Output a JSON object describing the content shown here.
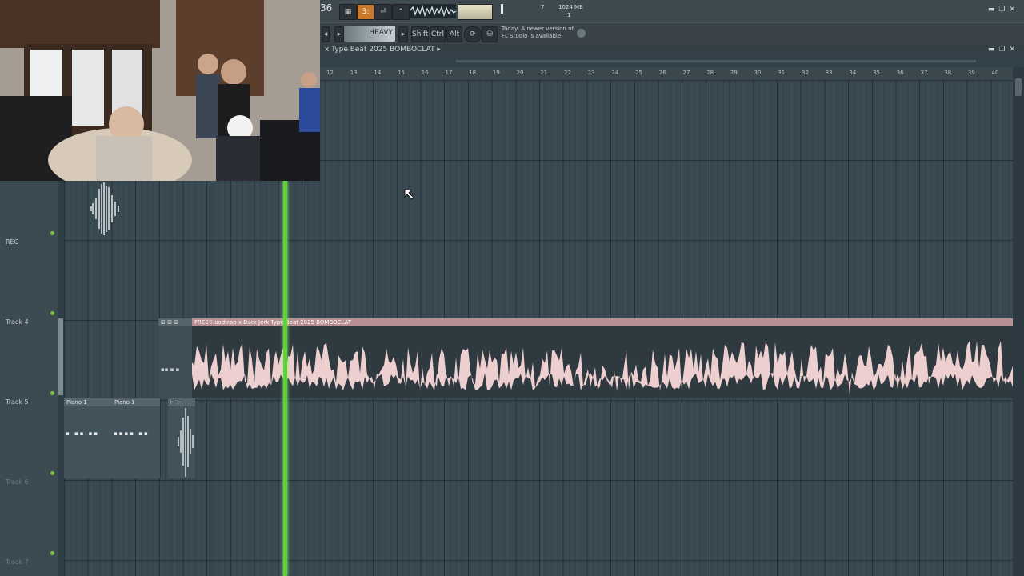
{
  "toolbar": {
    "counter_digits": "36",
    "preset_label": "HEAVY",
    "modifier_keys": [
      "Shift",
      "Ctrl",
      "Alt"
    ],
    "cpu_value": "7",
    "memory_value": "1024 MB",
    "voices_value": "1",
    "notification_day": "Today",
    "notification_line1": "A newer version of",
    "notification_line2": "FL Studio is available!"
  },
  "playlist": {
    "title": "x Type Beat 2025 BOMBOCLAT",
    "bar_numbers": [
      "12",
      "13",
      "14",
      "15",
      "16",
      "17",
      "18",
      "19",
      "20",
      "21",
      "22",
      "23",
      "24",
      "25",
      "26",
      "27",
      "28",
      "29",
      "30",
      "31",
      "32",
      "33",
      "34",
      "35",
      "36",
      "37",
      "38",
      "39",
      "40"
    ]
  },
  "tracks": {
    "rec_label": "REC",
    "track4": "Track 4",
    "track5": "Track 5",
    "track6": "Track 6",
    "track7": "Track 7"
  },
  "clips": {
    "audio_title": "FREE Hoodtrap x Dark Jerk Type Beat 2025 BOMBOCLAT",
    "piano1_a": "Piano 1",
    "piano1_b": "Piano 1"
  },
  "colors": {
    "accent_playhead": "#5fd43a",
    "audio_clip": "#eecfd0",
    "grid_bg": "#3a4a52"
  }
}
